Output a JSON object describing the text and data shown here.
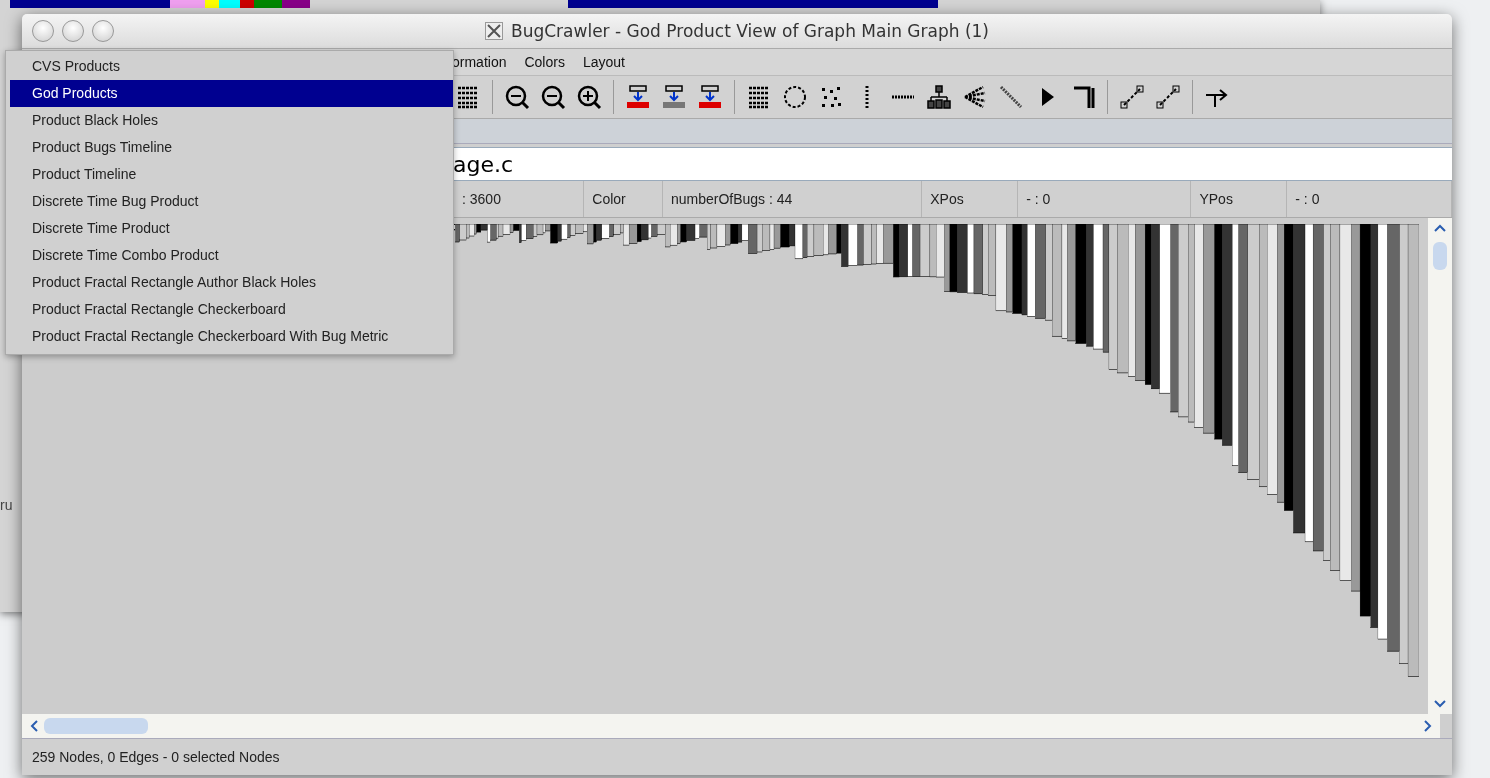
{
  "background_window": {
    "text": "ru"
  },
  "window": {
    "title": "BugCrawler - God Product View of Graph Main Graph (1)"
  },
  "menubar": [
    "ormation",
    "Colors",
    "Layout"
  ],
  "dropdown": [
    {
      "label": "CVS Products",
      "selected": false
    },
    {
      "label": "God Products",
      "selected": true
    },
    {
      "label": "Product Black Holes",
      "selected": false
    },
    {
      "label": "Product Bugs Timeline",
      "selected": false
    },
    {
      "label": "Product Timeline",
      "selected": false
    },
    {
      "label": "Discrete Time Bug Product",
      "selected": false
    },
    {
      "label": "Discrete Time Product",
      "selected": false
    },
    {
      "label": "Discrete Time Combo Product",
      "selected": false
    },
    {
      "label": "Product Fractal Rectangle Author Black Holes",
      "selected": false
    },
    {
      "label": "Product Fractal Rectangle Checkerboard",
      "selected": false
    },
    {
      "label": "Product Fractal Rectangle Checkerboard With Bug Metric",
      "selected": false
    }
  ],
  "search": {
    "value": "age.c"
  },
  "properties": [
    ": 3600",
    "Color",
    "numberOfBugs : 44",
    "XPos",
    "- : 0",
    "YPos",
    "- : 0"
  ],
  "status_bar": "259 Nodes, 0 Edges - 0 selected Nodes"
}
